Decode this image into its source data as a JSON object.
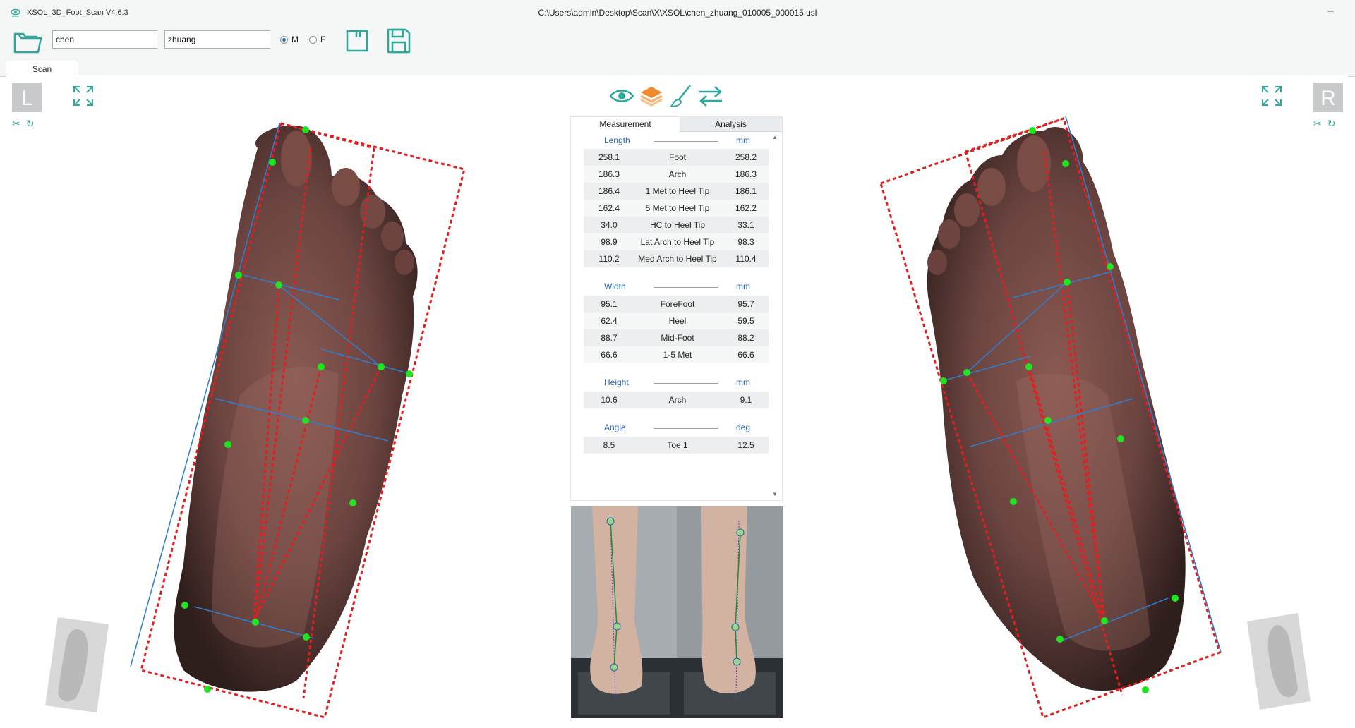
{
  "app": {
    "title": "XSOL_3D_Foot_Scan V4.6.3",
    "file_path": "C:\\Users\\admin\\Desktop\\Scan\\X\\XSOL\\chen_zhuang_010005_000015.usl",
    "minimize_label": "–"
  },
  "toolbar": {
    "first_name": "chen",
    "last_name": "zhuang",
    "gender_options": [
      {
        "label": "M",
        "selected": true
      },
      {
        "label": "F",
        "selected": false
      }
    ]
  },
  "tabs": {
    "scan": "Scan"
  },
  "sides": {
    "left": "L",
    "right": "R"
  },
  "panel": {
    "tabs": [
      "Measurement",
      "Analysis"
    ],
    "length": {
      "label": "Length",
      "unit": "mm",
      "rows": [
        {
          "left": "258.1",
          "name": "Foot",
          "right": "258.2"
        },
        {
          "left": "186.3",
          "name": "Arch",
          "right": "186.3"
        },
        {
          "left": "186.4",
          "name": "1 Met to Heel Tip",
          "right": "186.1"
        },
        {
          "left": "162.4",
          "name": "5 Met to Heel Tip",
          "right": "162.2"
        },
        {
          "left": "34.0",
          "name": "HC to Heel Tip",
          "right": "33.1"
        },
        {
          "left": "98.9",
          "name": "Lat Arch to Heel Tip",
          "right": "98.3"
        },
        {
          "left": "110.2",
          "name": "Med Arch to Heel Tip",
          "right": "110.4"
        }
      ]
    },
    "width": {
      "label": "Width",
      "unit": "mm",
      "rows": [
        {
          "left": "95.1",
          "name": "ForeFoot",
          "right": "95.7"
        },
        {
          "left": "62.4",
          "name": "Heel",
          "right": "59.5"
        },
        {
          "left": "88.7",
          "name": "Mid-Foot",
          "right": "88.2"
        },
        {
          "left": "66.6",
          "name": "1-5 Met",
          "right": "66.6"
        }
      ]
    },
    "height": {
      "label": "Height",
      "unit": "mm",
      "rows": [
        {
          "left": "10.6",
          "name": "Arch",
          "right": "9.1"
        }
      ]
    },
    "angle": {
      "label": "Angle",
      "unit": "deg",
      "rows": [
        {
          "left": "8.5",
          "name": "Toe 1",
          "right": "12.5"
        }
      ]
    }
  },
  "colors": {
    "accent": "#2fa89c",
    "section_blue": "#2e66a8",
    "overlay_red": "#e21f1f",
    "overlay_blue": "#2f7fd0",
    "marker_green": "#1ee61e"
  },
  "icons": [
    "app-logo-icon",
    "open-folder-icon",
    "new-document-icon",
    "save-disk-icon",
    "expand-icon",
    "scissors-icon",
    "rotate-icon",
    "eye-icon",
    "layers-icon",
    "brush-icon",
    "swap-arrows-icon"
  ]
}
